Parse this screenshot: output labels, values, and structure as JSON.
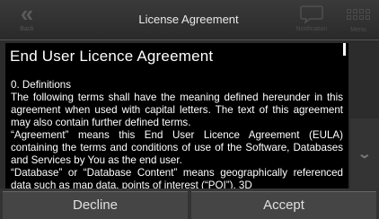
{
  "header": {
    "back_label": "Back",
    "title": "License Agreement",
    "notification_label": "Notification",
    "menu_label": "Menu"
  },
  "document": {
    "heading": "End User Licence Agreement",
    "paragraphs": [
      "0. Definitions",
      "The following terms shall have the meaning defined hereunder in this agreement when used with capital letters. The text of this agreement may also contain further defined terms.",
      "“Agreement” means this End User Licence Agreement (EULA) containing the terms and conditions of use of the Software, Databases and Services by You as the end user.",
      "“Database” or “Database Content” means geographically referenced data such as map data, points of interest (“POI”), 3D"
    ]
  },
  "buttons": {
    "decline": "Decline",
    "accept": "Accept"
  },
  "icons": {
    "back": "back-chevron-icon",
    "notification": "speech-bubble-icon",
    "menu": "grid-menu-icon",
    "scroll_down": "chevron-down-icon"
  }
}
